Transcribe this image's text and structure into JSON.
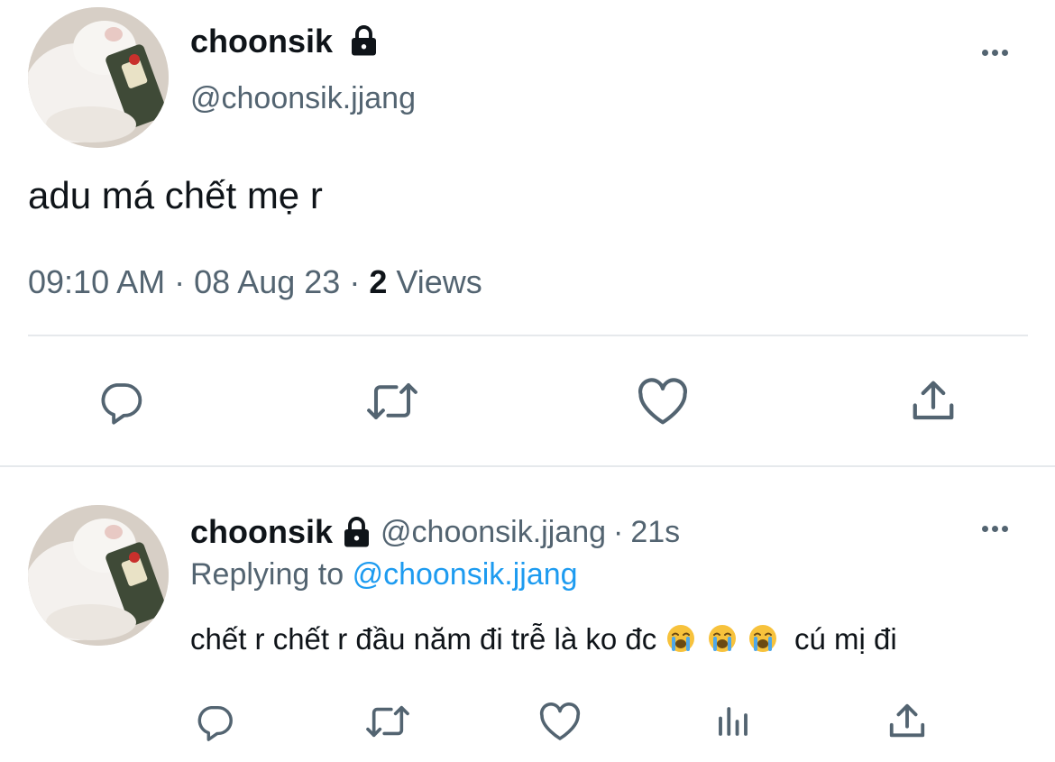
{
  "main_tweet": {
    "display_name": "choonsik",
    "handle": "@choonsik.jjang",
    "text": "adu má chết mẹ r",
    "time": "09:10 AM",
    "separator": "·",
    "date": "08 Aug 23",
    "views_count": "2",
    "views_label": "Views"
  },
  "reply": {
    "display_name": "choonsik",
    "handle": "@choonsik.jjang",
    "separator": "·",
    "age": "21s",
    "replying_prefix": "Replying to",
    "replying_to": "@choonsik.jjang",
    "text_main": "chết r chết r đầu năm đi trễ là ko đc",
    "text_tail": "cú mị đi",
    "emoji": [
      "loudly-crying-face",
      "loudly-crying-face",
      "loudly-crying-face"
    ]
  },
  "colors": {
    "text_primary": "#0f1419",
    "text_secondary": "#536471",
    "link": "#1d9bf0",
    "divider": "#e6e9ec"
  },
  "icons": {
    "main_actions": [
      "reply-icon",
      "retweet-icon",
      "like-icon",
      "share-icon"
    ],
    "reply_actions": [
      "reply-icon",
      "retweet-icon",
      "like-icon",
      "analytics-icon",
      "share-icon"
    ]
  }
}
